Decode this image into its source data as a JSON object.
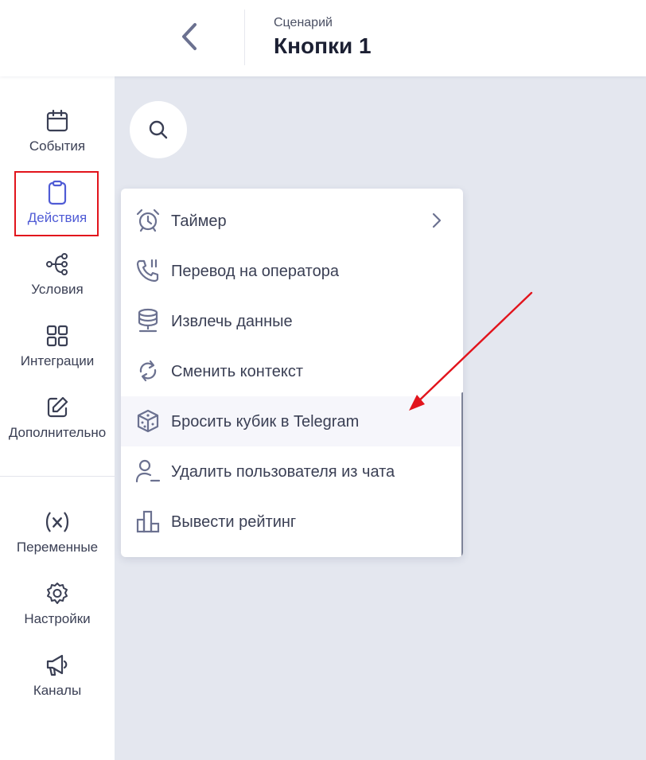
{
  "header": {
    "subtitle": "Сценарий",
    "title": "Кнопки 1"
  },
  "sidebar": {
    "items": [
      {
        "label": "События",
        "icon": "calendar-icon"
      },
      {
        "label": "Действия",
        "icon": "clipboard-icon",
        "active": true
      },
      {
        "label": "Условия",
        "icon": "branch-icon"
      },
      {
        "label": "Интеграции",
        "icon": "grid-icon"
      },
      {
        "label": "Дополнительно",
        "icon": "edit-icon"
      },
      {
        "label": "Переменные",
        "icon": "variable-icon"
      },
      {
        "label": "Настройки",
        "icon": "gear-icon"
      },
      {
        "label": "Каналы",
        "icon": "megaphone-icon"
      }
    ]
  },
  "menu": {
    "items": [
      {
        "label": "Таймер",
        "icon": "alarm-clock-icon",
        "has_submenu": true
      },
      {
        "label": "Перевод на оператора",
        "icon": "phone-transfer-icon"
      },
      {
        "label": "Извлечь данные",
        "icon": "database-icon"
      },
      {
        "label": "Сменить контекст",
        "icon": "refresh-icon"
      },
      {
        "label": "Бросить кубик в Telegram",
        "icon": "dice-icon",
        "hovered": true
      },
      {
        "label": "Удалить пользователя из чата",
        "icon": "user-remove-icon"
      },
      {
        "label": "Вывести рейтинг",
        "icon": "bar-chart-icon"
      }
    ]
  },
  "colors": {
    "accent": "#4f5bd5",
    "highlight_border": "#e2141c",
    "annotation_arrow": "#e2141c",
    "canvas_bg": "#e4e7ef",
    "text": "#3a3f54"
  }
}
